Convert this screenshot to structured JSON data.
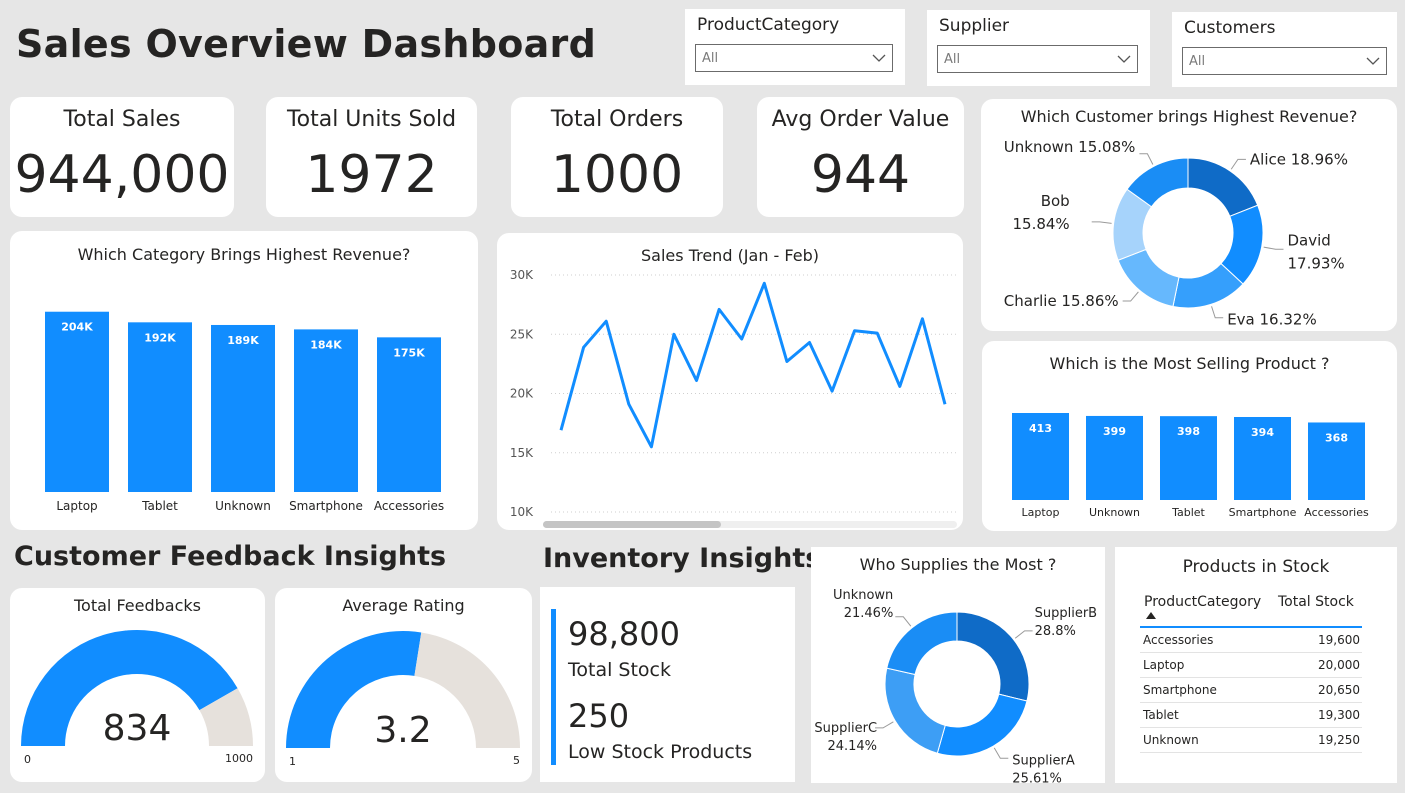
{
  "header": {
    "title": "Sales Overview Dashboard"
  },
  "slicers": [
    {
      "label": "ProductCategory",
      "value": "All"
    },
    {
      "label": "Supplier",
      "value": "All"
    },
    {
      "label": "Customers",
      "value": "All"
    }
  ],
  "kpis": [
    {
      "label": "Total Sales",
      "value": "944,000"
    },
    {
      "label": "Total Units Sold",
      "value": "1972"
    },
    {
      "label": "Total Orders",
      "value": "1000"
    },
    {
      "label": "Avg Order Value",
      "value": "944"
    }
  ],
  "sections": {
    "feedback": "Customer Feedback Insights",
    "inventory": "Inventory Insights"
  },
  "colors": {
    "primary": "#118dff",
    "gauge_rest": "#e6e1dc",
    "background": "#e6e6e6"
  },
  "chart_data": [
    {
      "id": "category_revenue",
      "type": "bar",
      "title": "Which Category Brings Highest Revenue?",
      "categories": [
        "Laptop",
        "Tablet",
        "Unknown",
        "Smartphone",
        "Accessories"
      ],
      "values": [
        204000,
        192000,
        189000,
        184000,
        175000
      ],
      "labels": [
        "204K",
        "192K",
        "189K",
        "184K",
        "175K"
      ],
      "ylim": [
        0,
        215000
      ]
    },
    {
      "id": "sales_trend",
      "type": "line",
      "title": "Sales Trend (Jan - Feb)",
      "y_ticks": [
        "30K",
        "25K",
        "20K",
        "15K",
        "10K"
      ],
      "ylim": [
        10000,
        30000
      ],
      "values": [
        16900,
        23900,
        26100,
        19100,
        15500,
        25000,
        21100,
        27100,
        24600,
        29300,
        22700,
        24300,
        20200,
        25300,
        25100,
        20600,
        26300,
        19100
      ]
    },
    {
      "id": "customer_revenue",
      "type": "pie",
      "title": "Which Customer brings Highest Revenue?",
      "slices": [
        {
          "name": "Alice",
          "value": 18.96,
          "label": "Alice 18.96%",
          "color": "#0f6bc7"
        },
        {
          "name": "David",
          "value": 17.93,
          "label": "David 17.93%",
          "color": "#118dff"
        },
        {
          "name": "Eva",
          "value": 16.32,
          "label": "Eva 16.32%",
          "color": "#359ffc"
        },
        {
          "name": "Charlie",
          "value": 15.86,
          "label": "Charlie 15.86%",
          "color": "#66b8fd"
        },
        {
          "name": "Bob",
          "value": 15.84,
          "label": "Bob 15.84%",
          "color": "#a6d3fb"
        },
        {
          "name": "Unknown",
          "value": 15.08,
          "label": "Unknown 15.08%",
          "color": "#1a8df5"
        }
      ]
    },
    {
      "id": "most_selling_product",
      "type": "bar",
      "title": "Which is the Most Selling Product ?",
      "categories": [
        "Laptop",
        "Unknown",
        "Tablet",
        "Smartphone",
        "Accessories"
      ],
      "values": [
        413,
        399,
        398,
        394,
        368
      ],
      "labels": [
        "413",
        "399",
        "398",
        "394",
        "368"
      ],
      "ylim": [
        0,
        413
      ]
    },
    {
      "id": "supplier_share",
      "type": "pie",
      "title": "Who Supplies the Most ?",
      "slices": [
        {
          "name": "SupplierB",
          "value": 28.8,
          "label_name": "SupplierB",
          "label_pct": "28.8%",
          "color": "#0f6bc7"
        },
        {
          "name": "SupplierA",
          "value": 25.61,
          "label_name": "SupplierA",
          "label_pct": "25.61%",
          "color": "#118dff"
        },
        {
          "name": "SupplierC",
          "value": 24.14,
          "label_name": "SupplierC",
          "label_pct": "24.14%",
          "color": "#3d9ef5"
        },
        {
          "name": "Unknown",
          "value": 21.46,
          "label_name": "Unknown",
          "label_pct": "21.46%",
          "color": "#1a8df5"
        }
      ]
    },
    {
      "id": "total_feedbacks",
      "type": "gauge",
      "title": "Total Feedbacks",
      "value": 834,
      "min": 0,
      "max": 1000,
      "value_label": "834",
      "min_label": "0",
      "max_label": "1000"
    },
    {
      "id": "average_rating",
      "type": "gauge",
      "title": "Average Rating",
      "value": 3.2,
      "min": 1,
      "max": 5,
      "value_label": "3.2",
      "min_label": "1",
      "max_label": "5"
    }
  ],
  "inventory": {
    "total_stock_value": "98,800",
    "total_stock_label": "Total Stock",
    "low_stock_value": "250",
    "low_stock_label": "Low Stock Products"
  },
  "stock_table": {
    "title": "Products in Stock",
    "columns": [
      "ProductCategory",
      "Total Stock"
    ],
    "rows": [
      [
        "Accessories",
        "19,600"
      ],
      [
        "Laptop",
        "20,000"
      ],
      [
        "Smartphone",
        "20,650"
      ],
      [
        "Tablet",
        "19,300"
      ],
      [
        "Unknown",
        "19,250"
      ]
    ]
  }
}
